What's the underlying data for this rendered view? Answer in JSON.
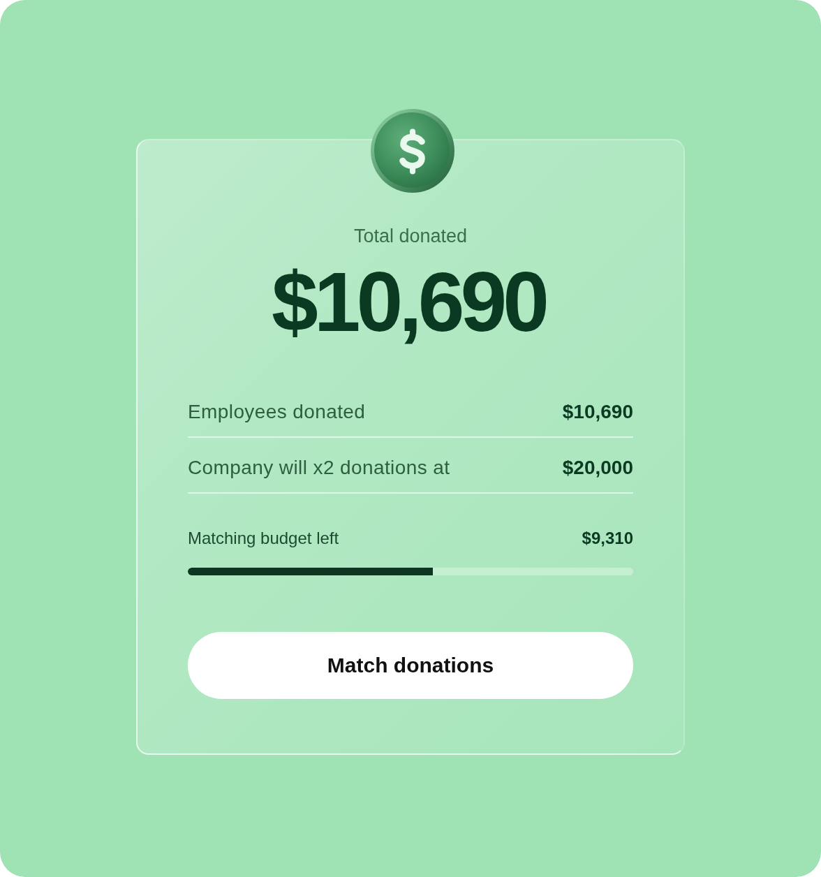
{
  "card": {
    "title": "Total donated",
    "total": "$10,690",
    "rows": [
      {
        "label": "Employees donated",
        "value": "$10,690"
      },
      {
        "label": "Company will x2 donations at",
        "value": "$20,000"
      }
    ],
    "budget": {
      "label": "Matching budget left",
      "value": "$9,310",
      "level": 0.55
    },
    "button": {
      "label": "Match donations"
    }
  }
}
